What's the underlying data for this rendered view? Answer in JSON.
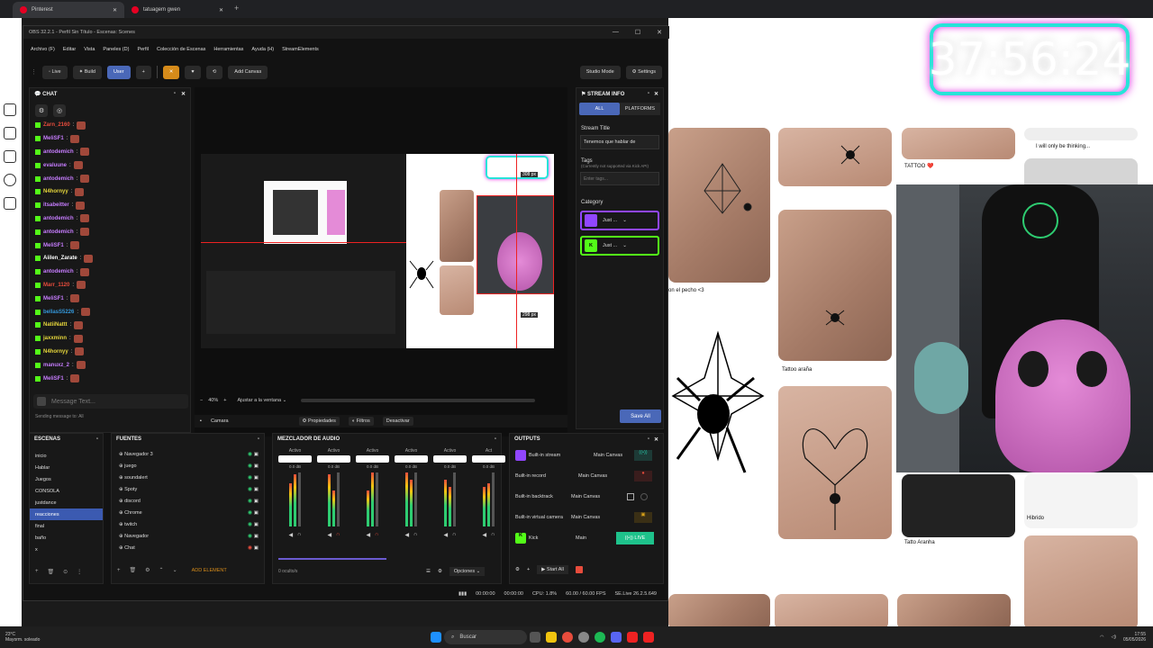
{
  "browser": {
    "tabs": [
      {
        "label": "Pinterest",
        "active": true
      },
      {
        "label": "tatuagem gwen",
        "active": false
      }
    ]
  },
  "background_page": {
    "captions": [
      "TATTOO ❤️",
      "I will only be thinking...",
      "on el pecho <3",
      "Tattoo araña",
      "Tatto Aranha",
      "Hibrido"
    ]
  },
  "overlay_clock": "37:56:24",
  "obs": {
    "title": "OBS 32.2.1 - Perfil Sin Título - Escenas: Scenes",
    "menu": [
      "Archivo (F)",
      "Editar",
      "Vista",
      "Paneles (D)",
      "Perfil",
      "Colección de Escenas",
      "Herramientas",
      "Ayuda (H)",
      "StreamElements"
    ],
    "toolbar": {
      "live": "Live",
      "build": "Build",
      "user": "User",
      "plus": "+",
      "add_canvas": "Add Canvas",
      "studio_mode": "Studio Mode",
      "settings": "Settings"
    },
    "chat": {
      "title": "CHAT",
      "messages": [
        {
          "user": "Zarn_2160",
          "color": "#e74c3c"
        },
        {
          "user": "MeliSF1",
          "color": "#c77dff"
        },
        {
          "user": "antodemich",
          "color": "#c77dff"
        },
        {
          "user": "evaluune",
          "color": "#c77dff"
        },
        {
          "user": "antodemich",
          "color": "#c77dff"
        },
        {
          "user": "N4hornyy",
          "color": "#e6d63b"
        },
        {
          "user": "itsabeitter",
          "color": "#c77dff"
        },
        {
          "user": "antodemich",
          "color": "#c77dff"
        },
        {
          "user": "antodemich",
          "color": "#c77dff"
        },
        {
          "user": "MeliSF1",
          "color": "#c77dff"
        },
        {
          "user": "Aiilen_Zarate",
          "color": "#ffffff"
        },
        {
          "user": "antodemich",
          "color": "#c77dff"
        },
        {
          "user": "Marr_1120",
          "color": "#e74c3c"
        },
        {
          "user": "MeliSF1",
          "color": "#c77dff"
        },
        {
          "user": "bellasS5226",
          "color": "#3498db"
        },
        {
          "user": "NatiiNattt",
          "color": "#e6d63b"
        },
        {
          "user": "jaxxminn",
          "color": "#e6d63b"
        },
        {
          "user": "N4hornyy",
          "color": "#e6d63b"
        },
        {
          "user": "manuxz_2",
          "color": "#c77dff"
        },
        {
          "user": "MeliSF1",
          "color": "#c77dff"
        }
      ],
      "input_placeholder": "Message Text...",
      "sending_to": "Sending message to: All"
    },
    "preview": {
      "inner_clock": "37:56:24",
      "zoom": "40%",
      "fit": "Ajustar a la ventana",
      "size_labels": [
        "308 px",
        "298 px"
      ]
    },
    "source_bar": {
      "source": "Camara",
      "properties": "Propiedades",
      "filters": "Filtros",
      "deactivate": "Desactivar"
    },
    "stream_info": {
      "title": "STREAM INFO",
      "tab_all": "ALL",
      "tab_platforms": "PLATFORMS",
      "stream_title_label": "Stream Title",
      "stream_title_value": "Tenemos que hablar de",
      "tags_label": "Tags",
      "tags_note": "(Currently not supported via Kick API)",
      "tags_placeholder": "Enter tags...",
      "category_label": "Category",
      "category_twitch": "Just ...",
      "category_kick": "Just ...",
      "save": "Save All"
    },
    "scenes": {
      "title": "ESCENAS",
      "items": [
        "inicio",
        "Hablar",
        "Juegos",
        "CONSOLA",
        "justdance",
        "reacciones",
        "final",
        "baño",
        "x"
      ],
      "selected_index": 5
    },
    "sources": {
      "title": "FUENTES",
      "items": [
        "Navegador 3",
        "juego",
        "soundalert",
        "Spoty",
        "discord",
        "Chrome",
        "twitch",
        "Navegador",
        "Chat"
      ],
      "add_element": "ADD ELEMENT"
    },
    "mixer": {
      "title": "MEZCLADOR DE AUDIO",
      "channels": [
        {
          "status": "Activo",
          "db": "0.0 dB"
        },
        {
          "status": "Activo",
          "db": "0.0 dB"
        },
        {
          "status": "Activo",
          "db": "0.0 dB"
        },
        {
          "status": "Activo",
          "db": "0.0 dB"
        },
        {
          "status": "Activo",
          "db": "0.0 dB"
        },
        {
          "status": "Act",
          "db": "0.0 dB"
        }
      ],
      "hidden": "0 oculto/s",
      "options": "Opciones"
    },
    "outputs": {
      "title": "OUTPUTS",
      "rows": [
        {
          "name": "Built-in stream",
          "canvas": "Main Canvas"
        },
        {
          "name": "Built-in record",
          "canvas": "Main Canvas"
        },
        {
          "name": "Built-in backtrack",
          "canvas": "Main Canvas"
        },
        {
          "name": "Built-in virtual camera",
          "canvas": "Main Canvas"
        },
        {
          "name": "Kick",
          "canvas": "Main"
        }
      ],
      "kick_button": "((•)) LIVE",
      "start_all": "Start All"
    },
    "statusbar": {
      "time1": "00:00:00",
      "time2": "00:00:00",
      "cpu": "CPU: 1.8%",
      "fps": "60.00 / 60.00 FPS",
      "se": "SE.Live 26.2.5.649"
    }
  },
  "taskbar": {
    "weather_temp": "23°C",
    "weather_desc": "Mayorm. soleado",
    "search": "Buscar",
    "time": "17:55",
    "date": "05/05/2026"
  }
}
